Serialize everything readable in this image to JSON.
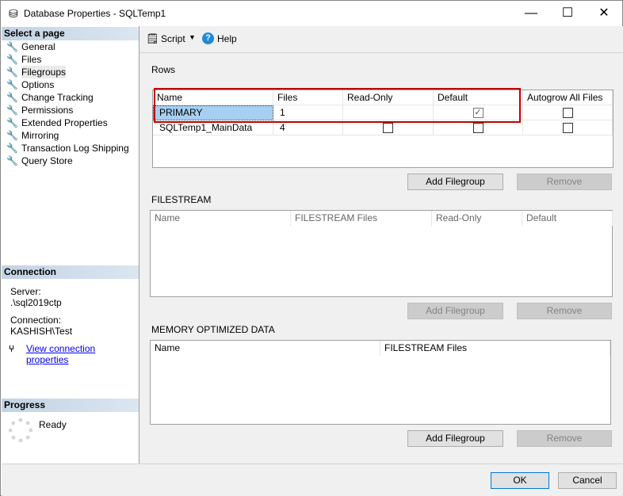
{
  "window": {
    "title": "Database Properties - SQLTemp1"
  },
  "sidebar": {
    "select_page": "Select a page",
    "items": [
      {
        "label": "General"
      },
      {
        "label": "Files"
      },
      {
        "label": "Filegroups"
      },
      {
        "label": "Options"
      },
      {
        "label": "Change Tracking"
      },
      {
        "label": "Permissions"
      },
      {
        "label": "Extended Properties"
      },
      {
        "label": "Mirroring"
      },
      {
        "label": "Transaction Log Shipping"
      },
      {
        "label": "Query Store"
      }
    ]
  },
  "connection": {
    "heading": "Connection",
    "server_label": "Server:",
    "server_value": ".\\sql2019ctp",
    "connection_label": "Connection:",
    "connection_value": "KASHISH\\Test",
    "link": "View connection properties"
  },
  "progress": {
    "heading": "Progress",
    "status": "Ready"
  },
  "toolbar": {
    "script": "Script",
    "help": "Help"
  },
  "rows": {
    "label": "Rows",
    "columns": [
      "Name",
      "Files",
      "Read-Only",
      "Default",
      "Autogrow All Files"
    ],
    "data": [
      {
        "name": "PRIMARY",
        "files": "1",
        "read_only": null,
        "default": true,
        "autogrow": false
      },
      {
        "name": "SQLTemp1_MainData",
        "files": "4",
        "read_only": false,
        "default": false,
        "autogrow": false
      }
    ],
    "add": "Add Filegroup",
    "remove": "Remove"
  },
  "filestream": {
    "label": "FILESTREAM",
    "columns": [
      "Name",
      "FILESTREAM Files",
      "Read-Only",
      "Default"
    ],
    "add": "Add Filegroup",
    "remove": "Remove"
  },
  "memory": {
    "label": "MEMORY OPTIMIZED DATA",
    "columns": [
      "Name",
      "FILESTREAM Files"
    ],
    "add": "Add Filegroup",
    "remove": "Remove"
  },
  "footer": {
    "ok": "OK",
    "cancel": "Cancel"
  },
  "colors": {
    "highlight": "#a6cff2",
    "red_box": "#c00000",
    "link": "#0000ee"
  }
}
